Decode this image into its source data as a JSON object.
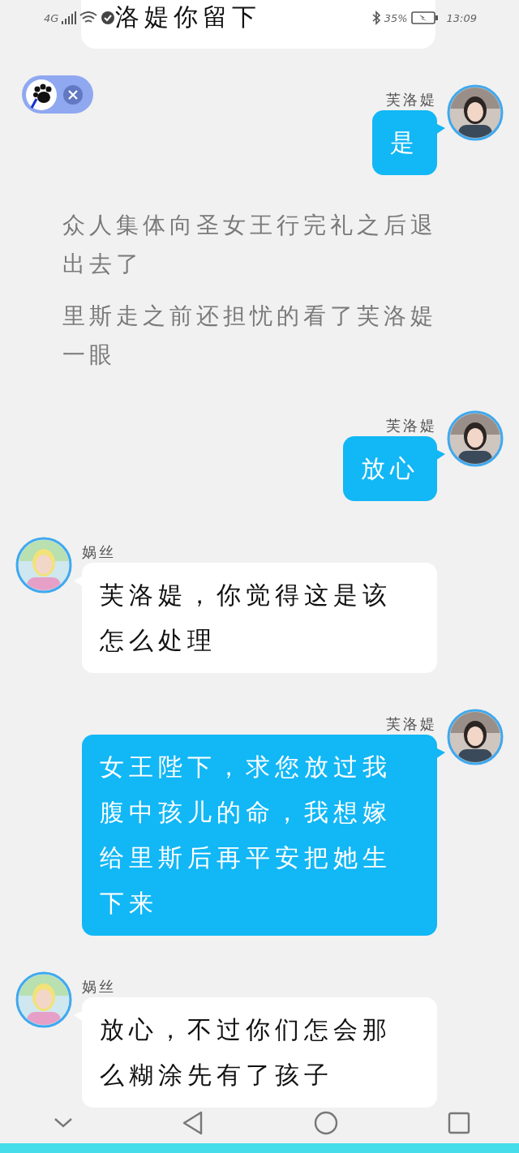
{
  "status_bar": {
    "network": "4G",
    "battery": "35%",
    "time": "13:09"
  },
  "messages": [
    {
      "kind": "cut",
      "text": "洛媞你留下"
    },
    {
      "kind": "right",
      "name": "芙洛媞",
      "text": "是"
    },
    {
      "kind": "narration",
      "text": "众人集体向圣女王行完礼之后退出去了"
    },
    {
      "kind": "narration",
      "text": "里斯走之前还担忧的看了芙洛媞一眼"
    },
    {
      "kind": "right",
      "name": "芙洛媞",
      "text": "放心"
    },
    {
      "kind": "left",
      "name": "娲丝",
      "text": "芙洛媞，你觉得这是该怎么处理"
    },
    {
      "kind": "right",
      "name": "芙洛媞",
      "text": "女王陛下，求您放过我腹中孩儿的命，我想嫁给里斯后再平安把她生下来"
    },
    {
      "kind": "left",
      "name": "娲丝",
      "text": "放心，不过你们怎会那么糊涂先有了孩子"
    }
  ]
}
